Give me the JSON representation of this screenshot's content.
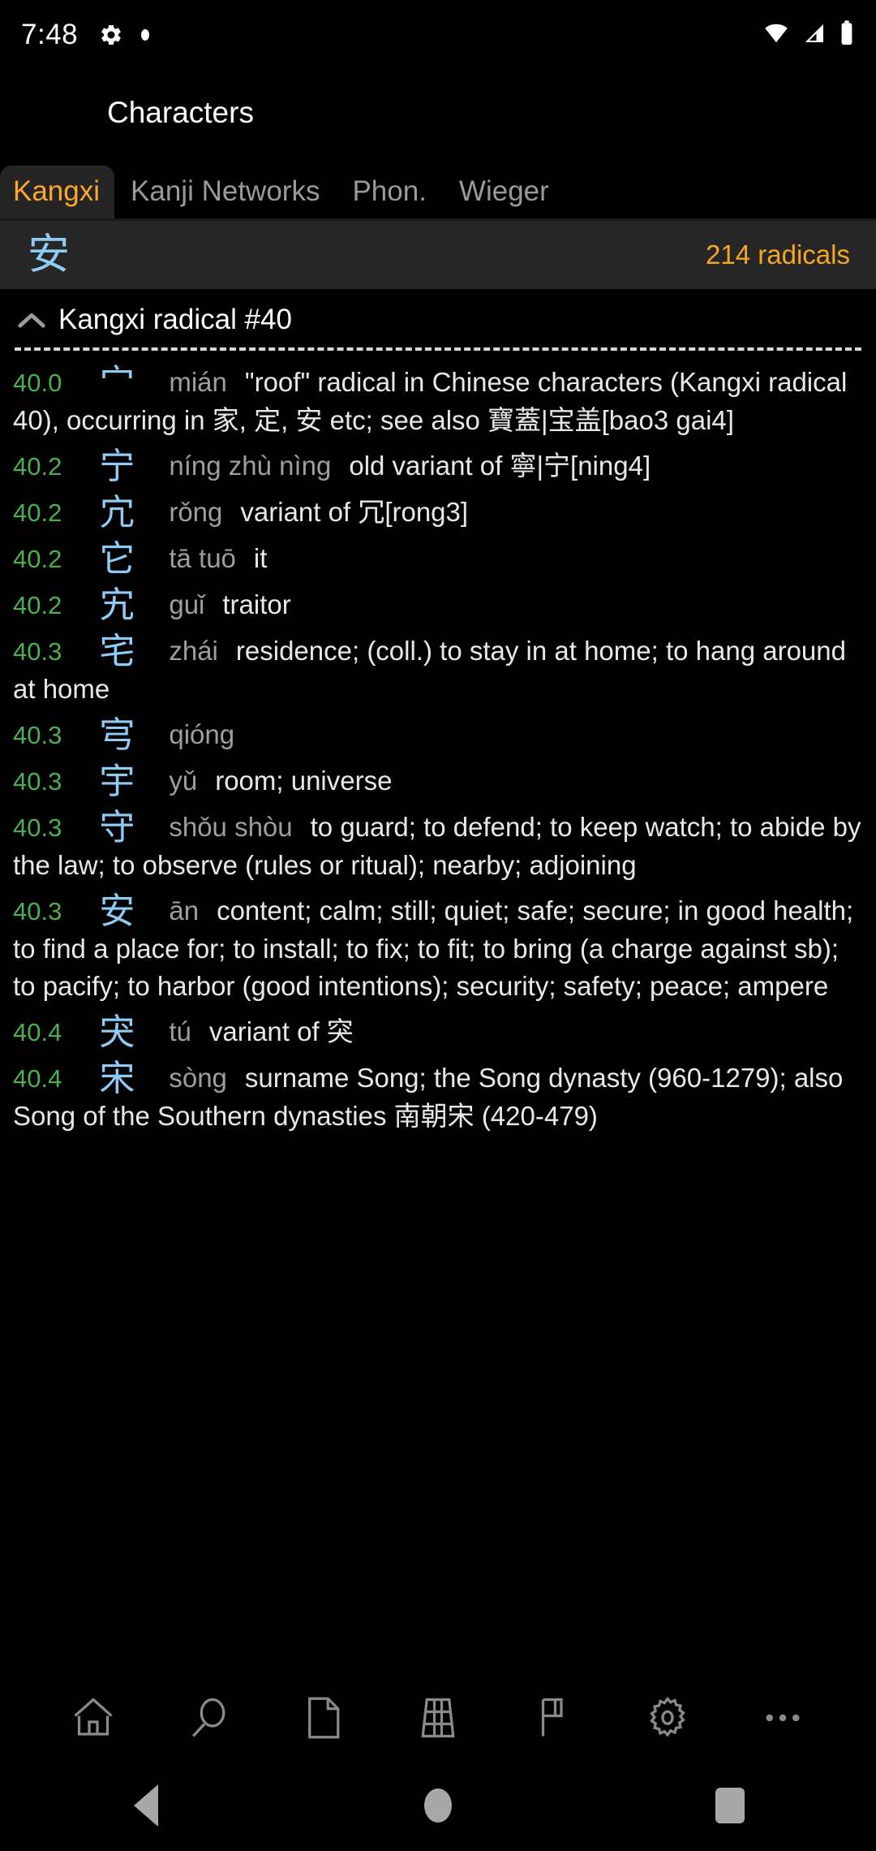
{
  "status_bar": {
    "time": "7:48",
    "left_icons": [
      "gear-icon",
      "dot-icon"
    ],
    "right_icons": [
      "wifi-icon",
      "cellular-signal-icon",
      "battery-icon"
    ]
  },
  "header": {
    "title": "Characters"
  },
  "tabs": [
    {
      "label": "Kangxi",
      "active": true
    },
    {
      "label": "Kanji Networks",
      "active": false
    },
    {
      "label": "Phon.",
      "active": false
    },
    {
      "label": "Wieger",
      "active": false
    }
  ],
  "radical_bar": {
    "character": "安",
    "count_label": "214 radicals",
    "character_color": "#8ecbf5",
    "count_color": "#f5a623"
  },
  "section": {
    "caret_icon": "chevron-up-icon",
    "label": "Kangxi radical #40"
  },
  "entries": [
    {
      "index": "40.0",
      "character": "宀",
      "pinyin": "mián",
      "definition": "\"roof\" radical in Chinese characters (Kangxi radical 40), occurring in 家, 定, 安 etc; see also 寶蓋|宝盖[bao3 gai4]"
    },
    {
      "index": "40.2",
      "character": "宁",
      "pinyin": "níng zhù nìng",
      "definition": "old variant of 寧|宁[ning4]"
    },
    {
      "index": "40.2",
      "character": "宂",
      "pinyin": "rǒng",
      "definition": "variant of 冗[rong3]"
    },
    {
      "index": "40.2",
      "character": "它",
      "pinyin": "tā tuō",
      "definition": "it"
    },
    {
      "index": "40.2",
      "character": "宄",
      "pinyin": "guǐ",
      "definition": "traitor"
    },
    {
      "index": "40.3",
      "character": "宅",
      "pinyin": "zhái",
      "definition": "residence; (coll.) to stay in at home; to hang around at home"
    },
    {
      "index": "40.3",
      "character": "宆",
      "pinyin": "qióng",
      "definition": ""
    },
    {
      "index": "40.3",
      "character": "宇",
      "pinyin": "yǔ",
      "definition": "room; universe"
    },
    {
      "index": "40.3",
      "character": "守",
      "pinyin": "shǒu shòu",
      "definition": "to guard; to defend; to keep watch; to abide by the law; to observe (rules or ritual); nearby; adjoining"
    },
    {
      "index": "40.3",
      "character": "安",
      "pinyin": "ān",
      "definition": "content; calm; still; quiet; safe; secure; in good health; to find a place for; to install; to fix; to fit; to bring (a charge against sb); to pacify; to harbor (good intentions); security; safety; peace; ampere"
    },
    {
      "index": "40.4",
      "character": "宊",
      "pinyin": "tú",
      "definition": "variant of 突"
    },
    {
      "index": "40.4",
      "character": "宋",
      "pinyin": "sòng",
      "definition": "surname Song; the Song dynasty (960-1279); also Song of the Southern dynasties 南朝宋 (420-479)"
    }
  ],
  "toolbar": [
    {
      "icon": "home-icon",
      "name": "home"
    },
    {
      "icon": "search-icon",
      "name": "search"
    },
    {
      "icon": "document-icon",
      "name": "document"
    },
    {
      "icon": "table-icon",
      "name": "table"
    },
    {
      "icon": "flag-icon",
      "name": "flag"
    },
    {
      "icon": "gear-icon",
      "name": "settings"
    },
    {
      "icon": "more-icon",
      "name": "more"
    }
  ],
  "nav_bar": [
    {
      "icon": "back-icon",
      "name": "back"
    },
    {
      "icon": "home-icon",
      "name": "home"
    },
    {
      "icon": "recents-icon",
      "name": "recents"
    }
  ]
}
